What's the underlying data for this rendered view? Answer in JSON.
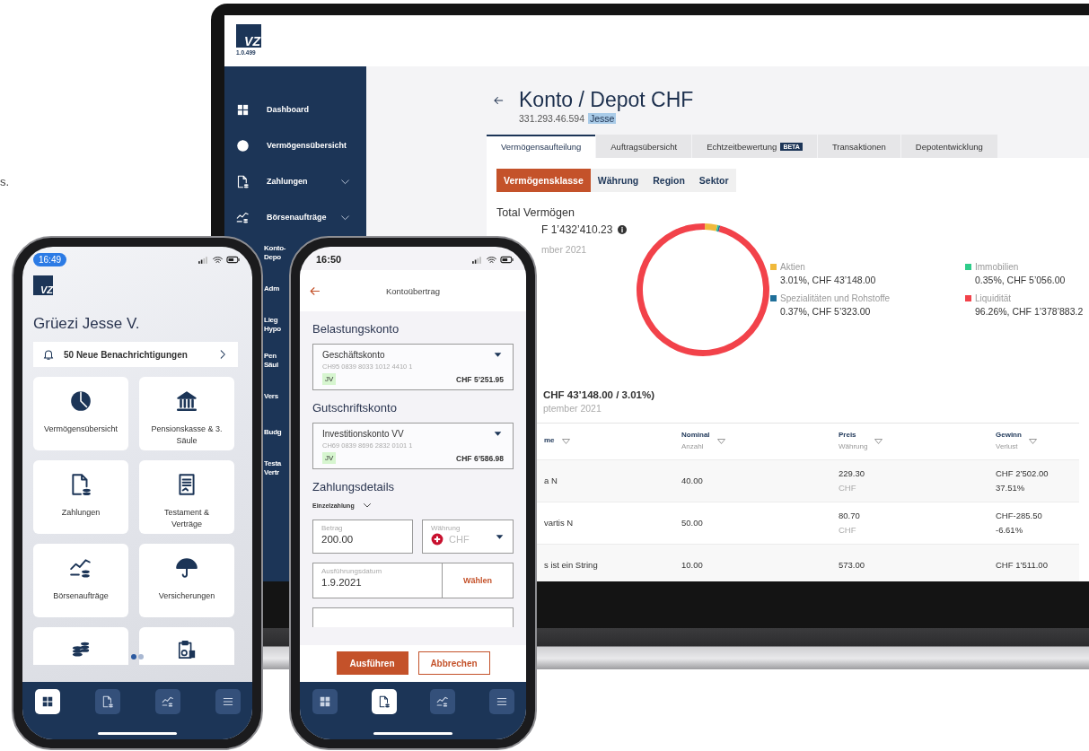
{
  "background_text": "s.",
  "laptop": {
    "logo": {
      "mark": "VZ",
      "version": "1.0.499"
    },
    "sidebar": {
      "items": [
        {
          "kind": "full",
          "lines": [
            "Dashboard"
          ],
          "expandable": false
        },
        {
          "kind": "full",
          "lines": [
            "Vermögensübersicht"
          ],
          "expandable": false
        },
        {
          "kind": "full",
          "lines": [
            "Zahlungen"
          ],
          "expandable": true
        },
        {
          "kind": "full",
          "lines": [
            "Börsenaufträge"
          ],
          "expandable": true
        },
        {
          "kind": "fragment",
          "lines": [
            "Konto-",
            "Depo"
          ]
        },
        {
          "kind": "fragment",
          "lines": [
            "Adm"
          ]
        },
        {
          "kind": "fragment",
          "lines": [
            "Lieg",
            "Hypo"
          ]
        },
        {
          "kind": "fragment",
          "lines": [
            "Pen",
            "Säul"
          ]
        },
        {
          "kind": "fragment",
          "lines": [
            "Vers"
          ]
        },
        {
          "kind": "fragment",
          "lines": [
            "Budg"
          ]
        },
        {
          "kind": "fragment",
          "lines": [
            "Testa",
            "Vertr"
          ]
        }
      ]
    },
    "page": {
      "title": "Konto / Depot CHF",
      "account": "331.293.46.594",
      "owner_tag": "Jesse"
    },
    "tabs": [
      {
        "label": "Vermögensaufteilung",
        "selected": true
      },
      {
        "label": "Auftragsübersicht",
        "selected": false
      },
      {
        "label": "Echtzeitbewertung",
        "badge": "BETA",
        "selected": false
      },
      {
        "label": "Transaktionen",
        "selected": false
      },
      {
        "label": "Depotentwicklung",
        "selected": false
      }
    ],
    "subtabs": [
      {
        "label": "Vermögensklasse",
        "selected": true
      },
      {
        "label": "Währung",
        "selected": false
      },
      {
        "label": "Region",
        "selected": false
      },
      {
        "label": "Sektor",
        "selected": false
      }
    ],
    "total": {
      "label": "Total Vermögen",
      "amount": "F 1’432’410.23",
      "date": "mber 2021"
    },
    "chart_data": {
      "type": "donut",
      "categories": [
        "Aktien",
        "Immobilien",
        "Spezialitäten und Rohstoffe",
        "Liquidität"
      ],
      "values": [
        3.01,
        0.35,
        0.37,
        96.26
      ]
    },
    "legend": [
      {
        "value": "3.01%, CHF 43’148.00",
        "color": "#f0b93b"
      },
      {
        "value": "0.35%, CHF 5’056.00",
        "color": "#2ecc8a"
      },
      {
        "value": "0.37%, CHF 5’323.00",
        "color": "#1f6f99"
      },
      {
        "value": "96.26%, CHF 1’378’883.2",
        "color": "#f2424a"
      }
    ],
    "detail": {
      "heading": "CHF 43’148.00 / 3.01%)",
      "date": "ptember 2021"
    },
    "table": {
      "columns": [
        {
          "label": "me"
        },
        {
          "label": "Nominal",
          "sublabel": "Anzahl"
        },
        {
          "label": "Preis",
          "sublabel": "Währung"
        },
        {
          "label": "Gewinn",
          "sublabel": "Verlust"
        }
      ],
      "rows": [
        {
          "name": "a N",
          "nominal": "40.00",
          "price": "229.30",
          "currency": "CHF",
          "gain": "CHF 2’502.00",
          "gain_pct": "37.51%"
        },
        {
          "name": "vartis N",
          "nominal": "50.00",
          "price": "80.70",
          "currency": "CHF",
          "gain": "CHF-285.50",
          "gain_pct": "-6.61%"
        },
        {
          "name": "s ist ein String",
          "nominal": "10.00",
          "price": "573.00",
          "gain": "CHF 1’511.00"
        }
      ]
    }
  },
  "phone_home": {
    "time": "16:49",
    "logo": "VZ",
    "greeting": "Grüezi Jesse V.",
    "notification": "50 Neue Benachrichtigungen",
    "tiles": [
      {
        "kind": "pie",
        "label": "Vermögensübersicht"
      },
      {
        "kind": "bank",
        "label": "Pensionskasse & 3. Säule"
      },
      {
        "kind": "doc",
        "label": "Zahlungen"
      },
      {
        "kind": "contract",
        "label": "Testament & Verträge"
      },
      {
        "kind": "chart",
        "label": "Börsenaufträge"
      },
      {
        "kind": "umbrella",
        "label": "Versicherungen"
      },
      {
        "kind": "coins"
      },
      {
        "kind": "clipboard"
      }
    ],
    "pager": [
      {
        "selected": true
      },
      {
        "selected": false
      }
    ],
    "nav": [
      {
        "kind": "grid",
        "selected": true
      },
      {
        "kind": "doc",
        "selected": false
      },
      {
        "kind": "chart",
        "selected": false
      },
      {
        "kind": "menu",
        "selected": false
      }
    ]
  },
  "phone_transfer": {
    "time": "16:50",
    "title": "Kontoübertrag",
    "accounts": [
      {
        "heading": "Belastungskonto",
        "name": "Geschäftskonto",
        "iban": "CH95 0839 8033 1012 4410 1",
        "tag": "JV",
        "balance": "CHF 5’251.95"
      },
      {
        "heading": "Gutschriftskonto",
        "name": "Investitionskonto VV",
        "iban": "CH69 0839 8696 2832 0101 1",
        "tag": "JV",
        "balance": "CHF 6’586.98"
      }
    ],
    "details": {
      "heading": "Zahlungsdetails",
      "type": "Einzelzahlung",
      "amount": {
        "label": "Betrag",
        "value": "200.00"
      },
      "currency": {
        "label": "Währung",
        "value": "CHF"
      },
      "date": {
        "label": "Ausführungsdatum",
        "value": "1.9.2021",
        "action": "Wählen"
      }
    },
    "buttons": {
      "primary": "Ausführen",
      "secondary": "Abbrechen"
    },
    "nav": [
      {
        "kind": "grid",
        "selected": false
      },
      {
        "kind": "doc",
        "selected": true
      },
      {
        "kind": "chart",
        "selected": false
      },
      {
        "kind": "menu",
        "selected": false
      }
    ]
  }
}
